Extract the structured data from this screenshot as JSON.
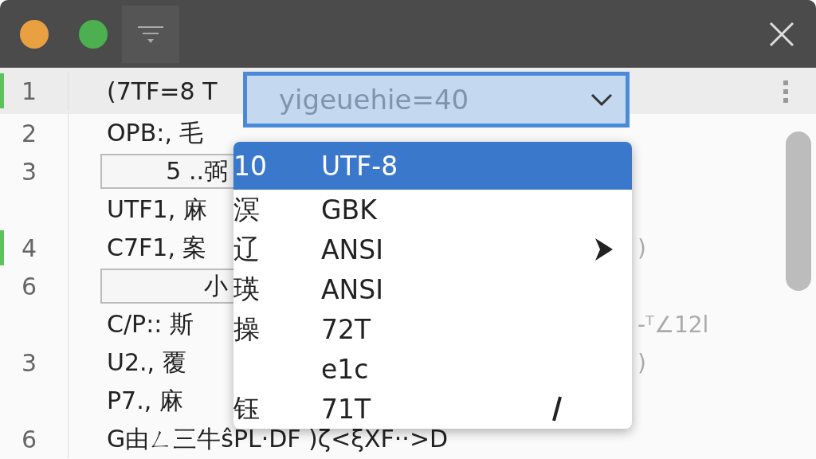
{
  "window": {
    "buttons": [
      {
        "kind": "minimize"
      },
      {
        "kind": "maximize"
      }
    ]
  },
  "editor": {
    "lines": [
      {
        "number": "1",
        "text": "(7TF=8 T",
        "boxed": false,
        "changed": true,
        "current": true
      },
      {
        "number": "2",
        "text": "OPB:, 毛",
        "boxed": false,
        "changed": false,
        "current": false
      },
      {
        "number": "3",
        "text": "5  ..弼",
        "boxed": true,
        "changed": false,
        "current": false
      },
      {
        "text": "UTF1, 麻",
        "boxed": false,
        "changed": false,
        "current": false
      },
      {
        "number": "4",
        "text": "C7F1, 案",
        "boxed": false,
        "changed": true,
        "current": false,
        "tail": ")"
      },
      {
        "number": "6",
        "text": "小",
        "boxed": true,
        "changed": false,
        "current": false
      },
      {
        "text": "C/P:: 斯",
        "boxed": false,
        "changed": false,
        "current": false,
        "tail": "-ᵀ∠12l"
      },
      {
        "number": "3",
        "text": "U2., 覆",
        "boxed": false,
        "changed": false,
        "current": false,
        "tail": ")"
      },
      {
        "text": "P7., 麻",
        "boxed": false,
        "changed": false,
        "current": false
      },
      {
        "number": "6",
        "text": "G由ㄥ三牛ŝPL·DF )ζ<ξXF··>D",
        "boxed": false,
        "changed": false,
        "current": false
      }
    ]
  },
  "encoding_field": {
    "placeholder": "yigeuehie=40"
  },
  "encoding_menu": [
    {
      "prefix": "10",
      "label": "UTF-8",
      "selected": true,
      "kind": "plain"
    },
    {
      "prefix": "溟",
      "label": "GBK",
      "selected": false,
      "kind": "plain"
    },
    {
      "prefix": "辽",
      "label": "ANSI",
      "selected": false,
      "kind": "submenu"
    },
    {
      "prefix": "瑛",
      "label": "ANSI",
      "selected": false,
      "kind": "plain"
    },
    {
      "prefix": "操",
      "label": "72T",
      "selected": false,
      "kind": "plain"
    },
    {
      "label": "e1c",
      "selected": false,
      "kind": "plain"
    },
    {
      "prefix": "钰",
      "label": "71T",
      "selected": false,
      "kind": "checked"
    }
  ]
}
